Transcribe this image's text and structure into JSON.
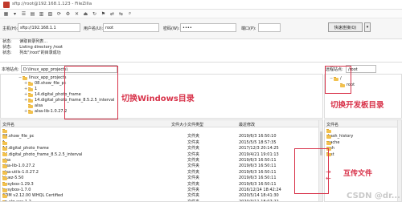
{
  "window": {
    "title": "sftp://root@192.168.1.123 - FileZilla"
  },
  "quickconnect": {
    "host_label": "主机(H):",
    "host_value": "sftp://192.168.1.1",
    "user_label": "用户名(U):",
    "user_value": "root",
    "password_label": "密码(W):",
    "password_value": "••••",
    "port_label": "端口(P):",
    "port_value": "",
    "connect_label": "快速连接(Q)",
    "dropdown": "▾"
  },
  "log": [
    {
      "label": "状态:",
      "text": "读取目录列表..."
    },
    {
      "label": "状态:",
      "text": "Listing directory /root"
    },
    {
      "label": "状态:",
      "text": "列出\"/root\"的目录成功"
    }
  ],
  "local": {
    "path_label": "本地站点:",
    "path_value": "D:\\linux_app_projects\\",
    "tree": [
      {
        "label": "linux_app_projects",
        "expander": "−",
        "level": 0
      },
      {
        "label": "08.show_file_pc",
        "expander": "+",
        "level": 1
      },
      {
        "label": "1",
        "expander": "+",
        "level": 1
      },
      {
        "label": "14.digital_photo_frame",
        "expander": "+",
        "level": 1
      },
      {
        "label": "14.digital_photo_frame_8.5.2.5_interval",
        "expander": "+",
        "level": 1
      },
      {
        "label": "alsa",
        "expander": "",
        "level": 1
      },
      {
        "label": "alsa-lib-1.0.27.2",
        "expander": "+",
        "level": 1
      }
    ],
    "headers": {
      "name": "文件名",
      "size": "文件大小",
      "type": "文件类型",
      "modified": "最近修改"
    },
    "files": [
      {
        "name": "..",
        "size": "",
        "type": "",
        "modified": ""
      },
      {
        "name": "08.show_file_pc",
        "size": "",
        "type": "文件夹",
        "modified": "2019/6/3 16:50:10"
      },
      {
        "name": "1",
        "size": "",
        "type": "文件夹",
        "modified": "2015/5/5 18:57:35"
      },
      {
        "name": "14.digital_photo_frame",
        "size": "",
        "type": "文件夹",
        "modified": "2017/12/3 20:14:25"
      },
      {
        "name": "14.digital_photo_frame_8.5.2.5_interval",
        "size": "",
        "type": "文件夹",
        "modified": "2019/4/21 19:01:13"
      },
      {
        "name": "alsa",
        "size": "",
        "type": "文件夹",
        "modified": "2019/6/3 16:50:11"
      },
      {
        "name": "alsa-lib-1.0.27.2",
        "size": "",
        "type": "文件夹",
        "modified": "2019/6/3 16:50:11"
      },
      {
        "name": "alsa-utils-1.0.27.2",
        "size": "",
        "type": "文件夹",
        "modified": "2019/6/3 16:50:11"
      },
      {
        "name": "bluez-5.50",
        "size": "",
        "type": "文件夹",
        "modified": "2019/6/3 16:50:11"
      },
      {
        "name": "busybox-1.29.3",
        "size": "",
        "type": "文件夹",
        "modified": "2019/6/3 16:50:11"
      },
      {
        "name": "busybox-1.7.0",
        "size": "",
        "type": "文件夹",
        "modified": "2016/12/14 18:42:24"
      },
      {
        "name": "CDM v2.12.00 WHQL Certified",
        "size": "",
        "type": "文件夹",
        "modified": "2020/5/14 18:41:30"
      },
      {
        "name": "cp-alg-xxx-1.2",
        "size": "",
        "type": "文件夹",
        "modified": "2020/3/11 18:07:22"
      }
    ]
  },
  "remote": {
    "path_label": "远程站点:",
    "path_value": "/root",
    "tree": [
      {
        "label": "/",
        "expander": "−",
        "level": 0
      },
      {
        "label": "root",
        "expander": "",
        "level": 1
      }
    ],
    "headers": {
      "name": "文件名"
    },
    "files": [
      {
        "name": ".."
      },
      {
        "name": ".bash_history"
      },
      {
        "name": ".cache"
      },
      {
        "name": ".ssh"
      },
      {
        "name": "test"
      }
    ]
  },
  "annotations": {
    "windows_dir": "切换Windows目录",
    "board_dir": "切换开发板目录",
    "transfer": "互传文件",
    "watermark": "CSDN @dr..."
  }
}
